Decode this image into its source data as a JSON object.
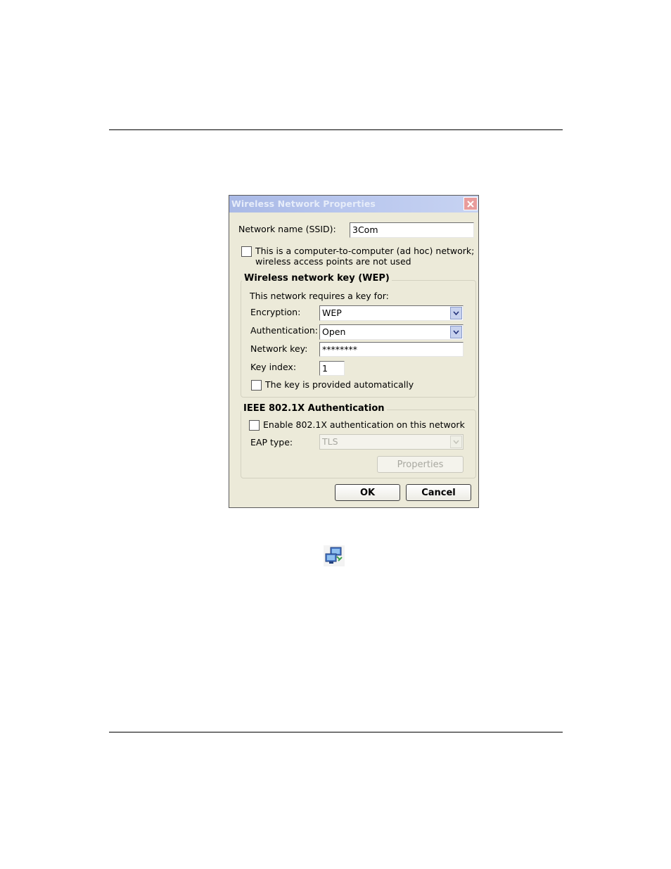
{
  "dialog": {
    "title": "Wireless Network Properties",
    "close_glyph": "✕",
    "ssid_label": "Network name (SSID):",
    "ssid_value": "3Com",
    "adhoc_line1": "This is a computer-to-computer (ad hoc) network;",
    "adhoc_line2": "wireless access points are not used",
    "wep_group": {
      "title": "Wireless network key (WEP)",
      "requires_text": "This network requires a key for:",
      "encryption_label": "Encryption:",
      "encryption_value": "WEP",
      "auth_label": "Authentication:",
      "auth_value": "Open",
      "key_label": "Network key:",
      "key_value": "********",
      "index_label": "Key index:",
      "index_value": "1",
      "auto_key_label": "The key is provided automatically"
    },
    "ieee_group": {
      "title": "IEEE 802.1X Authentication",
      "enable_label": "Enable 802.1X authentication on this network",
      "eap_label": "EAP type:",
      "eap_value": "TLS",
      "properties_label": "Properties"
    },
    "ok_label": "OK",
    "cancel_label": "Cancel"
  },
  "icons": [
    "close-icon",
    "chevron-down-icon",
    "network-icon"
  ],
  "colors": {
    "title_bar": "#b9c7ee",
    "dialog_bg": "#ecead9",
    "close_btn": "#e89c9c"
  }
}
